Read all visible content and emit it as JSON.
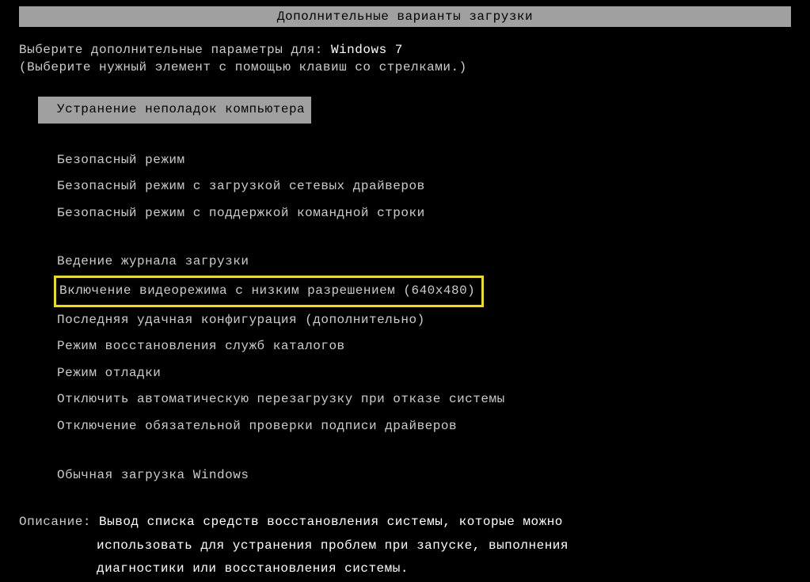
{
  "title": "Дополнительные варианты загрузки",
  "prompt": {
    "label": "Выберите дополнительные параметры для: ",
    "os_name": "Windows 7"
  },
  "hint": "(Выберите нужный элемент с помощью клавиш со стрелками.)",
  "menu": {
    "selected_item": "Устранение неполадок компьютера",
    "group1": [
      "Безопасный режим",
      "Безопасный режим с загрузкой сетевых драйверов",
      "Безопасный режим с поддержкой командной строки"
    ],
    "group2_before": [
      "Ведение журнала загрузки"
    ],
    "highlighted_item": "Включение видеорежима с низким разрешением (640x480)",
    "group2_after": [
      "Последняя удачная конфигурация (дополнительно)",
      "Режим восстановления служб каталогов",
      "Режим отладки",
      "Отключить автоматическую перезагрузку при отказе системы",
      "Отключение обязательной проверки подписи драйверов"
    ],
    "group3": [
      "Обычная загрузка Windows"
    ]
  },
  "description": {
    "label": "Описание: ",
    "line1": "Вывод списка средств восстановления системы, которые можно",
    "line2": "использовать для устранения проблем при запуске, выполнения",
    "line3": "диагностики или восстановления системы."
  }
}
